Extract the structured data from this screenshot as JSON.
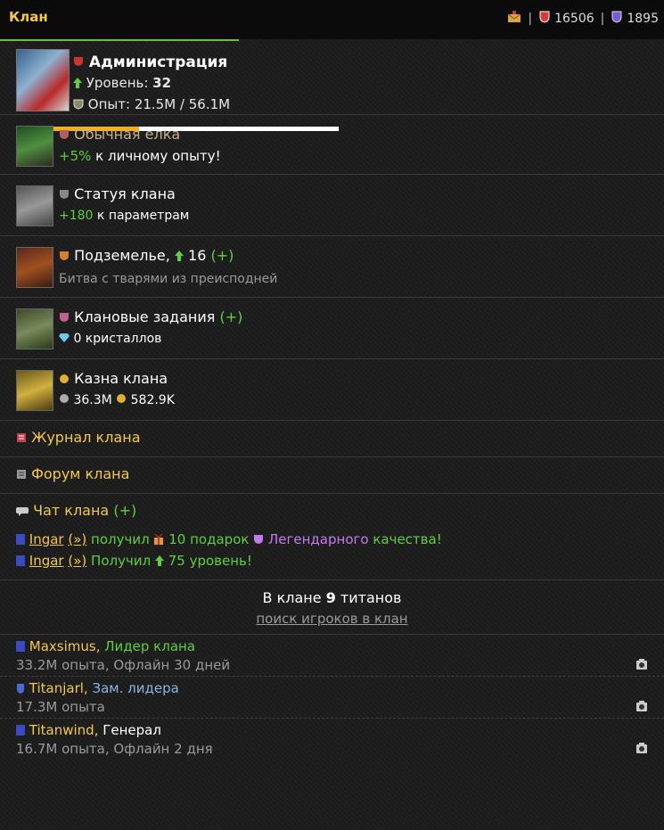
{
  "topbar": {
    "title": "Клан",
    "gold": "16506",
    "crystals": "1895"
  },
  "clan": {
    "name": "Администрация",
    "level_label": "Уровень:",
    "level": "32",
    "exp_label": "Опыт:",
    "exp_value": "21.5M / 56.1M",
    "exp_progress": 0.38
  },
  "rows": {
    "tree": {
      "title": "Обычная елка",
      "bonus_value": "+5%",
      "bonus_text": "к личному опыту!"
    },
    "statue": {
      "title": "Статуя клана",
      "bonus_value": "+180",
      "bonus_text": "к параметрам"
    },
    "dungeon": {
      "title": "Подземелье,",
      "level": "16",
      "plus": "(+)",
      "subtitle": "Битва с тварями из преисподней"
    },
    "tasks": {
      "title": "Клановые задания",
      "plus": "(+)",
      "subtitle": "0 кристаллов"
    },
    "treasury": {
      "title": "Казна клана",
      "silver": "36.3M",
      "gold": "582.9K"
    }
  },
  "links": {
    "journal": "Журнал клана",
    "forum": "Форум клана",
    "chat": "Чат клана",
    "chat_plus": "(+)"
  },
  "chat": [
    {
      "user": "Ingar",
      "arrow": "(»)",
      "text1": "получил",
      "count": "10 подарок",
      "quality": "Легендарного",
      "text2": "качества!"
    },
    {
      "user": "Ingar",
      "arrow": "(»)",
      "text1": "Получил",
      "count": "75 уровень!"
    }
  ],
  "members_header": {
    "prefix": "В клане",
    "count": "9",
    "suffix": "титанов",
    "search_link": "поиск игроков в клан"
  },
  "members": [
    {
      "name": "Maxsimus,",
      "role": "Лидер клана",
      "info": "33.2M опыта, Офлайн 30 дней"
    },
    {
      "name": "Titanjarl,",
      "role": "Зам. лидера",
      "info": "17.3M опыта"
    },
    {
      "name": "Titanwind,",
      "role": "Генерал",
      "info": "16.7M опыта, Офлайн 2 дня"
    }
  ],
  "colors": {
    "accent_gold": "#f2c94c",
    "green": "#5fcf3f",
    "purple": "#c57bf0",
    "progress": "#f2b01e"
  }
}
